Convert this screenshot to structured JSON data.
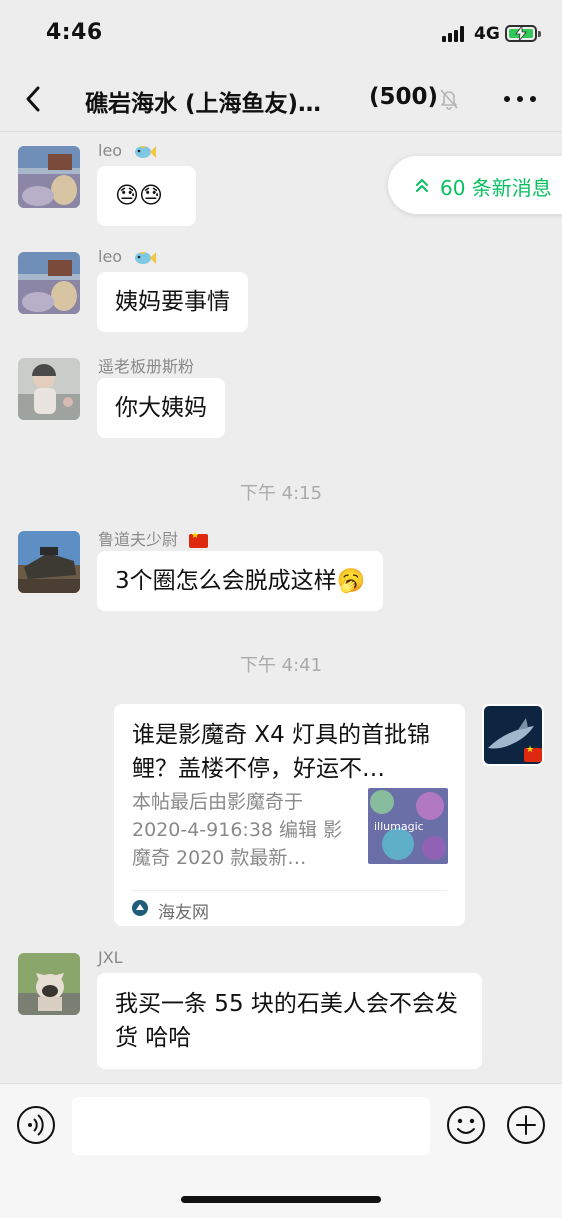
{
  "status_bar": {
    "time": "4:46",
    "network": "4G",
    "battery_level": 1.0
  },
  "nav": {
    "title": "礁岩海水 (上海鱼友)…",
    "member_count": "(500)",
    "icons": {
      "back": "chevron-left-icon",
      "mute": "bell-slash-icon",
      "more": "more-dots-icon"
    }
  },
  "new_messages_pill": {
    "text": "60 条新消息",
    "icon": "double-chevron-up-icon",
    "color": "#07c160"
  },
  "messages": [
    {
      "sender": "leo",
      "sender_badge": "fish-emoji",
      "text": "😓😓"
    },
    {
      "sender": "leo",
      "sender_badge": "fish-emoji",
      "text": "姨妈要事情"
    },
    {
      "sender": "遥老板册斯粉",
      "text": "你大姨妈"
    },
    {
      "sender": "鲁道夫少尉",
      "sender_badge": "china-flag",
      "text": "3个圈怎么会脱成这样🥱"
    },
    {
      "sender": "JXL",
      "text": "我买一条 55 块的石美人会不会发货 哈哈"
    }
  ],
  "time_separators": [
    "下午 4:15",
    "下午 4:41"
  ],
  "link_card": {
    "title": "谁是影魔奇 X4 灯具的首批锦鲤？盖楼不停，好运不…",
    "description": "本帖最后由影魔奇于 2020-4-916:38 编辑 影魔奇 2020 款最新…",
    "source": "海友网",
    "thumbnail_text": "illumagic"
  },
  "input_bar": {
    "placeholder": "",
    "icons": {
      "voice": "voice-icon",
      "emoji": "emoji-icon",
      "plus": "plus-icon"
    }
  },
  "colors": {
    "background": "#ededed",
    "bubble": "#ffffff",
    "accent": "#07c160",
    "muted_text": "#8a8a8a"
  }
}
